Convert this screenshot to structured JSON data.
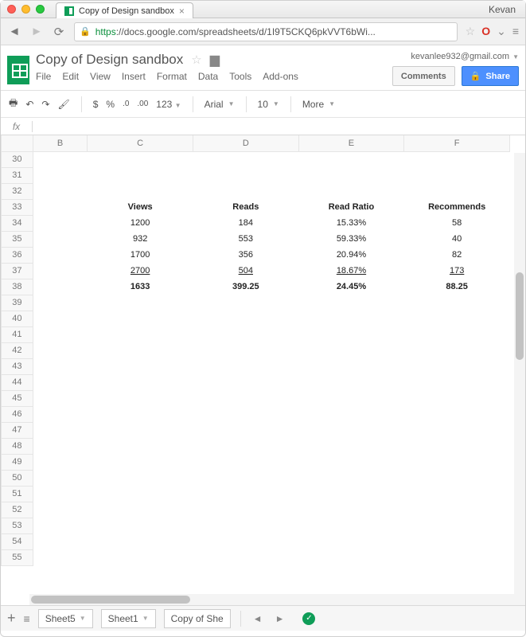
{
  "window": {
    "profile_name": "Kevan",
    "tab_title": "Copy of Design sandbox"
  },
  "address": {
    "scheme": "https",
    "url_rest": "://docs.google.com/spreadsheets/d/1I9T5CKQ6pkVVT6bWi..."
  },
  "sheets": {
    "doc_title": "Copy of Design sandbox",
    "user_email": "kevanlee932@gmail.com",
    "menus": [
      "File",
      "Edit",
      "View",
      "Insert",
      "Format",
      "Data",
      "Tools",
      "Add-ons"
    ],
    "comments_label": "Comments",
    "share_label": "Share"
  },
  "toolbar": {
    "currency": "$",
    "percent": "%",
    "dec_less": ".0",
    "dec_more": ".00",
    "num_format": "123",
    "font_name": "Arial",
    "font_size": "10",
    "more_label": "More"
  },
  "formula": {
    "label": "fx",
    "value": ""
  },
  "columns": [
    "B",
    "C",
    "D",
    "E",
    "F"
  ],
  "row_start": 30,
  "row_end": 55,
  "data": {
    "headers_row": 33,
    "headers": {
      "C": "Views",
      "D": "Reads",
      "E": "Read Ratio",
      "F": "Recommends"
    },
    "rows": [
      {
        "r": 34,
        "C": "1200",
        "D": "184",
        "E": "15.33%",
        "F": "58"
      },
      {
        "r": 35,
        "C": "932",
        "D": "553",
        "E": "59.33%",
        "F": "40"
      },
      {
        "r": 36,
        "C": "1700",
        "D": "356",
        "E": "20.94%",
        "F": "82"
      },
      {
        "r": 37,
        "C": "2700",
        "D": "504",
        "E": "18.67%",
        "F": "173",
        "style": "underline"
      },
      {
        "r": 38,
        "C": "1633",
        "D": "399.25",
        "E": "24.45%",
        "F": "88.25",
        "style": "bold"
      }
    ]
  },
  "tabs": {
    "add": "+",
    "sheets": [
      "Sheet5",
      "Sheet1",
      "Copy of She"
    ]
  },
  "chart_data": {
    "type": "table",
    "title": "Copy of Design sandbox",
    "columns": [
      "Views",
      "Reads",
      "Read Ratio",
      "Recommends"
    ],
    "rows": [
      [
        1200,
        184,
        "15.33%",
        58
      ],
      [
        932,
        553,
        "59.33%",
        40
      ],
      [
        1700,
        356,
        "20.94%",
        82
      ],
      [
        2700,
        504,
        "18.67%",
        173
      ]
    ],
    "summary": [
      1633,
      399.25,
      "24.45%",
      88.25
    ]
  }
}
